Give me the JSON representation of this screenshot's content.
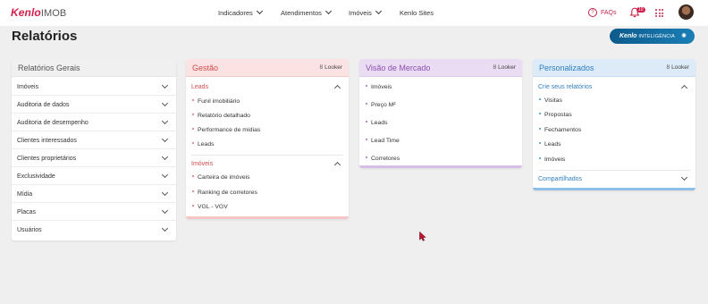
{
  "header": {
    "brand": "Kenlo",
    "brand_suffix": "IMOB",
    "nav": [
      {
        "label": "Indicadores",
        "has_dropdown": true
      },
      {
        "label": "Atendimentos",
        "has_dropdown": true
      },
      {
        "label": "Imóveis",
        "has_dropdown": true
      },
      {
        "label": "Kenlo Sites",
        "has_dropdown": false
      }
    ],
    "faq_label": "FAQs",
    "faq_icon": "question-circle-icon",
    "notifications_badge": "10",
    "apps_icon": "grid-dots-icon"
  },
  "page": {
    "title": "Relatórios",
    "ai_button": {
      "brand": "Kenlo",
      "label": "INTELIGÊNCIA",
      "icon": "sparkle-icon"
    }
  },
  "colors": {
    "brand": "#d21f4b",
    "gestao_header": "#fbe3e3",
    "gestao_accent": "#e26a6a",
    "mercado_header": "#eadcf2",
    "mercado_accent": "#a06cc0",
    "personalizados_header": "#dcebf7",
    "personalizados_accent": "#3d8fd1",
    "ai_button": "#0d5b8c"
  },
  "cards": {
    "gerais": {
      "title": "Relatórios Gerais",
      "items": [
        "Imóveis",
        "Auditoria de dados",
        "Auditoria de desempenho",
        "Clientes interessados",
        "Clientes proprietários",
        "Exclusividade",
        "Mídia",
        "Placas",
        "Usuários"
      ]
    },
    "gestao": {
      "title": "Gestão",
      "looker": "Looker",
      "sections": [
        {
          "title": "Leads",
          "expanded": true,
          "items": [
            "Funil imobiliário",
            "Relatório detalhado",
            "Performance de mídias",
            "Leads"
          ]
        },
        {
          "title": "Imóveis",
          "expanded": true,
          "items": [
            "Carteira de imóveis",
            "Ranking de corretores",
            "VGL - VGV"
          ]
        }
      ]
    },
    "mercado": {
      "title": "Visão de Mercado",
      "looker": "Looker",
      "items": [
        "Imóveis",
        "Preço M²",
        "Leads",
        "Lead Time",
        "Corretores"
      ]
    },
    "personalizados": {
      "title": "Personalizados",
      "looker": "Looker",
      "sections": [
        {
          "title": "Crie seus relatórios",
          "expanded": true,
          "items": [
            "Visitas",
            "Propostas",
            "Fechamentos",
            "Leads",
            "Imóveis"
          ]
        },
        {
          "title": "Compartilhados",
          "expanded": false,
          "items": []
        }
      ]
    }
  }
}
